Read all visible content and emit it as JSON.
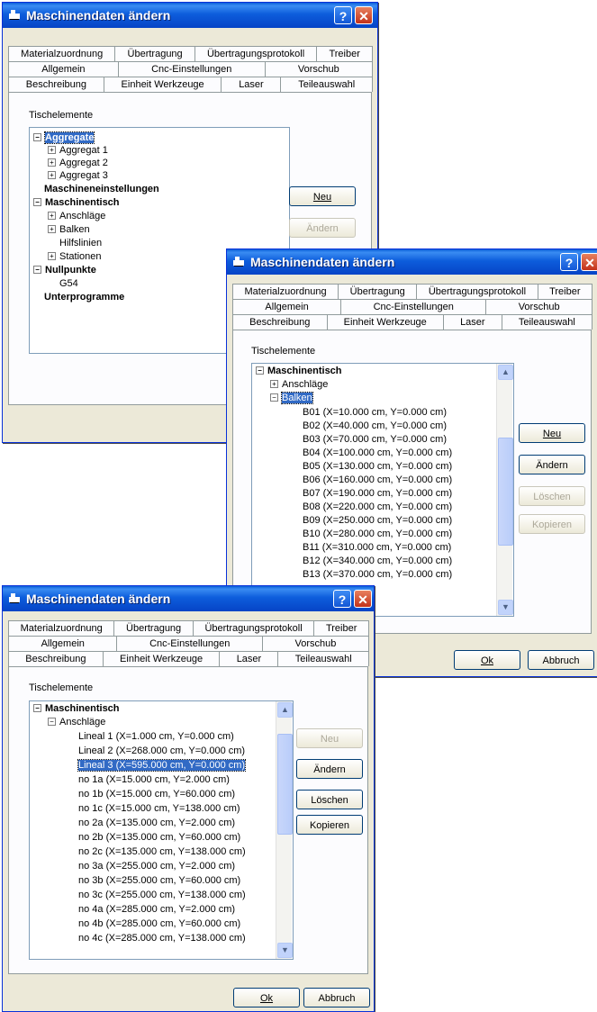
{
  "title": "Maschinendaten ändern",
  "tabs": {
    "row1": [
      "Materialzuordnung",
      "Übertragung",
      "Übertragungsprotokoll",
      "Treiber"
    ],
    "row2": [
      "Allgemein",
      "Cnc-Einstellungen",
      "Vorschub"
    ],
    "row3": [
      "Beschreibung",
      "Einheit Werkzeuge",
      "Laser",
      "Teileauswahl"
    ]
  },
  "section_label": "Tischelemente",
  "buttons": {
    "neu": "Neu",
    "aendern": "Ändern",
    "loeschen": "Löschen",
    "kopieren": "Kopieren",
    "ok": "Ok",
    "abbruch": "Abbruch"
  },
  "dialog1": {
    "tree": [
      "Aggregate",
      "Aggregat 1",
      "Aggregat 2",
      "Aggregat 3",
      "Maschineneinstellungen",
      "Maschinentisch",
      "Anschläge",
      "Balken",
      "Hilfslinien",
      "Stationen",
      "Nullpunkte",
      "G54",
      "Unterprogramme"
    ]
  },
  "dialog2": {
    "tree": [
      "Maschinentisch",
      "Anschläge",
      "Balken",
      "B01 (X=10.000 cm, Y=0.000 cm)",
      "B02 (X=40.000 cm, Y=0.000 cm)",
      "B03 (X=70.000 cm, Y=0.000 cm)",
      "B04 (X=100.000 cm, Y=0.000 cm)",
      "B05 (X=130.000 cm, Y=0.000 cm)",
      "B06 (X=160.000 cm, Y=0.000 cm)",
      "B07 (X=190.000 cm, Y=0.000 cm)",
      "B08 (X=220.000 cm, Y=0.000 cm)",
      "B09 (X=250.000 cm, Y=0.000 cm)",
      "B10 (X=280.000 cm, Y=0.000 cm)",
      "B11 (X=310.000 cm, Y=0.000 cm)",
      "B12 (X=340.000 cm, Y=0.000 cm)",
      "B13 (X=370.000 cm, Y=0.000 cm)"
    ]
  },
  "dialog3": {
    "tree": [
      "Maschinentisch",
      "Anschläge",
      "Lineal 1 (X=1.000 cm, Y=0.000 cm)",
      "Lineal 2 (X=268.000 cm, Y=0.000 cm)",
      "Lineal 3 (X=595.000 cm, Y=0.000 cm)",
      "no 1a (X=15.000 cm, Y=2.000 cm)",
      "no 1b (X=15.000 cm, Y=60.000 cm)",
      "no 1c (X=15.000 cm, Y=138.000 cm)",
      "no 2a (X=135.000 cm, Y=2.000 cm)",
      "no 2b (X=135.000 cm, Y=60.000 cm)",
      "no 2c (X=135.000 cm, Y=138.000 cm)",
      "no 3a (X=255.000 cm, Y=2.000 cm)",
      "no 3b (X=255.000 cm, Y=60.000 cm)",
      "no 3c (X=255.000 cm, Y=138.000 cm)",
      "no 4a (X=285.000 cm, Y=2.000 cm)",
      "no 4b (X=285.000 cm, Y=60.000 cm)",
      "no 4c (X=285.000 cm, Y=138.000 cm)"
    ]
  }
}
